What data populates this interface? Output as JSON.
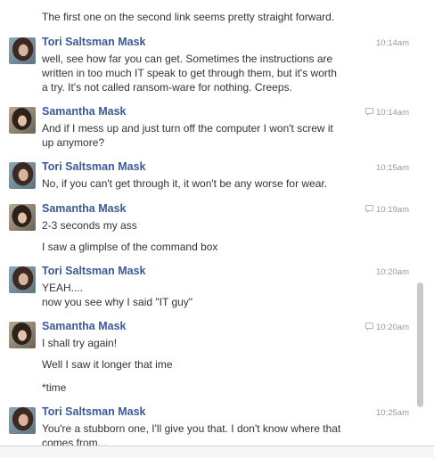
{
  "conversation": {
    "top_partial_line": "The first one on the second link seems pretty straight forward.",
    "messages": [
      {
        "sender": "Tori Saltsman Mask",
        "time": "10:14am",
        "seen": false,
        "lines": [
          "well, see how far you can get. Sometimes the instructions are",
          "written in too much IT speak to get through them, but it's worth",
          "a try. It's not called ransom-ware for nothing. Creeps."
        ]
      },
      {
        "sender": "Samantha Mask",
        "time": "10:14am",
        "seen": true,
        "lines": [
          "And if I mess up and just turn off the computer I won't screw it",
          "up anymore?"
        ]
      },
      {
        "sender": "Tori Saltsman Mask",
        "time": "10:15am",
        "seen": false,
        "lines": [
          "No, if you can't get through it, it won't be any worse for wear."
        ]
      },
      {
        "sender": "Samantha Mask",
        "time": "10:19am",
        "seen": true,
        "lines": [
          "2-3 seconds my ass",
          "I saw a glimplse of the command box"
        ]
      },
      {
        "sender": "Tori Saltsman Mask",
        "time": "10:20am",
        "seen": false,
        "lines": [
          "YEAH....",
          "now you see why I said \"IT guy\""
        ]
      },
      {
        "sender": "Samantha Mask",
        "time": "10:20am",
        "seen": true,
        "lines": [
          "I shall try again!",
          "Well I saw it longer that ime",
          "*time"
        ]
      },
      {
        "sender": "Tori Saltsman Mask",
        "time": "10:25am",
        "seen": false,
        "lines": [
          "You're a stubborn one, I'll give you that. I don't know where that",
          "comes from..."
        ]
      }
    ]
  }
}
